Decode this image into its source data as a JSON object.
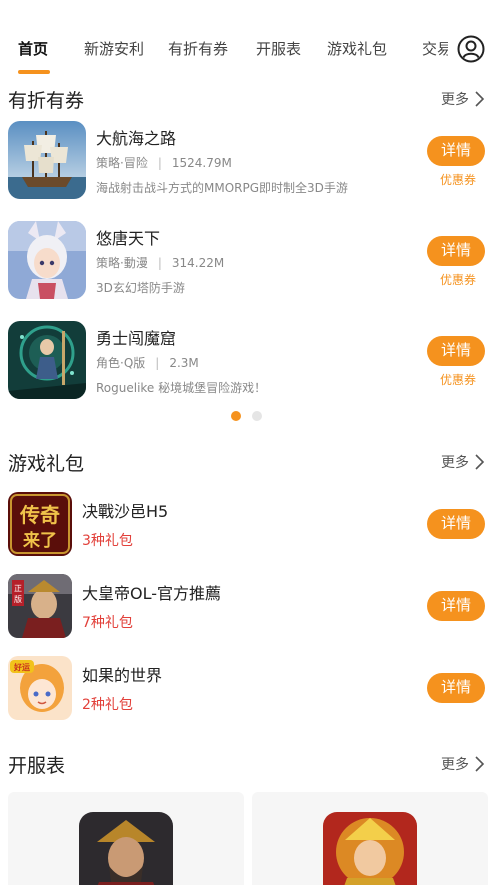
{
  "nav": {
    "tabs": [
      "首页",
      "新游安利",
      "有折有券",
      "开服表",
      "游戏礼包",
      "交易"
    ],
    "active_index": 0,
    "user_icon": "user-circle-icon"
  },
  "sections": {
    "coupons": {
      "title": "有折有券",
      "more": "更多"
    },
    "gifts": {
      "title": "游戏礼包",
      "more": "更多"
    },
    "servers": {
      "title": "开服表",
      "more": "更多"
    }
  },
  "coupon_games": [
    {
      "name": "大航海之路",
      "genre": "策略·冒险",
      "size": "1524.79M",
      "desc": "海战射击战斗方式的MMORPG即时制全3D手游",
      "button": "详情",
      "tag": "优惠券"
    },
    {
      "name": "悠唐天下",
      "genre": "策略·動漫",
      "size": "314.22M",
      "desc": "3D玄幻塔防手游",
      "button": "详情",
      "tag": "优惠券"
    },
    {
      "name": "勇士闯魔窟",
      "genre": "角色·Q版",
      "size": "2.3M",
      "desc": "Roguelike 秘境城堡冒险游戏！",
      "button": "详情",
      "tag": "优惠券"
    }
  ],
  "gift_games": [
    {
      "name": "决戰沙邑H5",
      "count": "3种礼包",
      "button": "详情",
      "icon_text": "传奇来了"
    },
    {
      "name": "大皇帝OL-官方推薦",
      "count": "7种礼包",
      "button": "详情",
      "icon_text": "正版"
    },
    {
      "name": "如果的世界",
      "count": "2种礼包",
      "button": "详情",
      "icon_text": "好运"
    }
  ],
  "colors": {
    "accent": "#f5921e",
    "gift_count": "#e2403a"
  },
  "carousel": {
    "pages": 2,
    "current": 1
  }
}
